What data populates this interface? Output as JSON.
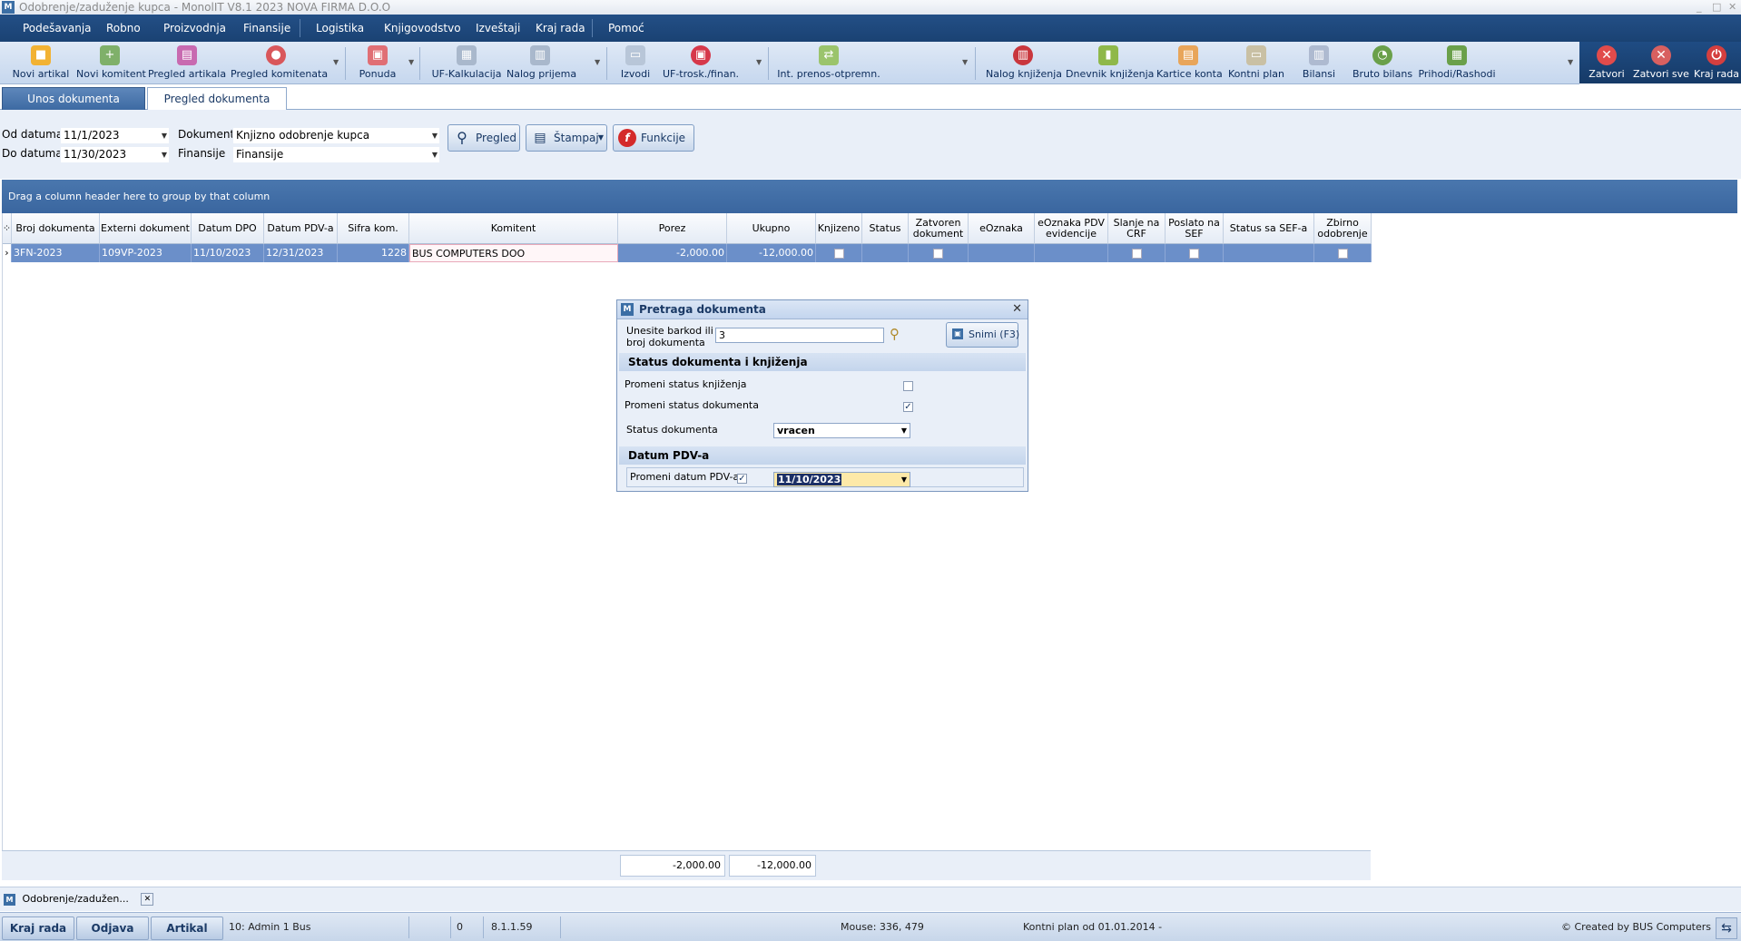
{
  "window": {
    "title": "Odobrenje/zaduženje kupca - MonolIT V8.1 2023 NOVA FIRMA D.O.O",
    "controls": [
      "_",
      "□",
      "✕"
    ]
  },
  "menu": [
    "Podešavanja",
    "Robno",
    "Proizvodnja",
    "Finansije",
    "Logistika",
    "Knjigovodstvo",
    "Izveštaji",
    "Kraj rada",
    "Pomoć"
  ],
  "toolbar": [
    {
      "label": "Novi artikal",
      "icon": "box-icon",
      "color": "#f2b233"
    },
    {
      "label": "Novi komitent",
      "icon": "user-add-icon",
      "color": "#7fb06a"
    },
    {
      "label": "Pregled artikala",
      "icon": "items-icon",
      "color": "#c86ab0"
    },
    {
      "label": "Pregled komitenata",
      "icon": "clients-icon",
      "color": "#d9575b"
    },
    {
      "label": "Ponuda",
      "icon": "offer-icon",
      "color": "#e06f75"
    },
    {
      "label": "UF-Kalkulacija",
      "icon": "calc-icon",
      "color": "#a9b8cc"
    },
    {
      "label": "Nalog prijema",
      "icon": "receipt-icon",
      "color": "#a9b8cc"
    },
    {
      "label": "Izvodi",
      "icon": "statement-icon",
      "color": "#b8c6d8"
    },
    {
      "label": "UF-trosk./finan.",
      "icon": "gift-icon",
      "color": "#d6384a"
    },
    {
      "label": "Int. prenos-otpremn.",
      "icon": "transfer-icon",
      "color": "#9bc46c"
    },
    {
      "label": "Nalog knjiženja",
      "icon": "book-icon",
      "color": "#c9363d"
    },
    {
      "label": "Dnevnik knjiženja",
      "icon": "journal-icon",
      "color": "#8fb84a"
    },
    {
      "label": "Kartice konta",
      "icon": "cards-icon",
      "color": "#e8a55a"
    },
    {
      "label": "Kontni plan",
      "icon": "plan-icon",
      "color": "#c9c0a4"
    },
    {
      "label": "Bilansi",
      "icon": "balance-icon",
      "color": "#aebad0"
    },
    {
      "label": "Bruto bilans",
      "icon": "pie-icon",
      "color": "#6aa04a"
    },
    {
      "label": "Prihodi/Rashodi",
      "icon": "income-icon",
      "color": "#6aa04a"
    }
  ],
  "rightbar": [
    {
      "label": "Zatvori",
      "icon": "close-icon",
      "glyph": "✕",
      "color": "#e14b4b"
    },
    {
      "label": "Zatvori sve",
      "icon": "close-all-icon",
      "glyph": "✕",
      "color": "#d86060"
    },
    {
      "label": "Kraj rada",
      "icon": "power-icon",
      "glyph": "⏻",
      "color": "#d43f3f"
    }
  ],
  "tabs": {
    "unos": "Unos dokumenta",
    "pregled": "Pregled dokumenta"
  },
  "filters": {
    "od_label": "Od datuma",
    "od_value": "11/1/2023",
    "do_label": "Do datuma",
    "do_value": "11/30/2023",
    "dok_label": "Dokument",
    "dok_value": "Knjizno odobrenje kupca",
    "fin_label": "Finansije",
    "fin_value": "Finansije",
    "btn_pregled": "Pregled",
    "btn_stampaj": "Štampaj",
    "btn_funkcije": "Funkcije"
  },
  "grid": {
    "group_hint": "Drag a column header here to group by that column",
    "columns": [
      "Broj dokumenta",
      "Externi dokument",
      "Datum DPO",
      "Datum PDV-a",
      "Sifra kom.",
      "Komitent",
      "Porez",
      "Ukupno",
      "Knjizeno",
      "Status",
      "Zatvoren dokument",
      "eOznaka",
      "eOznaka PDV evidencije",
      "Slanje na CRF",
      "Poslato na SEF",
      "Status sa SEF-a",
      "Zbirno odobrenje"
    ],
    "rows": [
      {
        "broj": "3FN-2023",
        "externi": "109VP-2023",
        "datum_dpo": "11/10/2023",
        "datum_pdv": "12/31/2023",
        "sifra": "1228",
        "komitent": "BUS COMPUTERS DOO",
        "porez": "-2,000.00",
        "ukupno": "-12,000.00",
        "knjizeno": false,
        "status": "",
        "zatvoren": false,
        "eoznaka": "",
        "eoznaka_pdv": "",
        "crf": false,
        "sef": false,
        "status_sef": "",
        "zbirno": false
      }
    ],
    "totals": {
      "porez": "-2,000.00",
      "ukupno": "-12,000.00"
    }
  },
  "dialog": {
    "title": "Pretraga dokumenta",
    "barcode_label_1": "Unesite barkod ili",
    "barcode_label_2": "broj dokumenta",
    "barcode_value": "3",
    "save_button": "Snimi (F3)",
    "section_status": "Status dokumenta i knjiženja",
    "promeni_knjizenje": "Promeni status knjiženja",
    "promeni_knjizenje_checked": false,
    "promeni_dokument": "Promeni status dokumenta",
    "promeni_dokument_checked": true,
    "status_label": "Status dokumenta",
    "status_value": "vracen",
    "section_pdv": "Datum PDV-a",
    "promeni_datum": "Promeni datum PDV-a",
    "promeni_datum_checked": true,
    "datum_value": "11/10/2023"
  },
  "mdi": {
    "doc": "Odobrenje/zadužen..."
  },
  "statusbar": {
    "kraj": "Kraj rada",
    "odjava": "Odjava",
    "artikal": "Artikal",
    "user": "10: Admin 1 Bus",
    "count": "0",
    "version": "8.1.1.59",
    "mouse": "Mouse: 336, 479",
    "plan": "Kontni plan od 01.01.2014 -",
    "credit": "© Created by BUS Computers"
  }
}
